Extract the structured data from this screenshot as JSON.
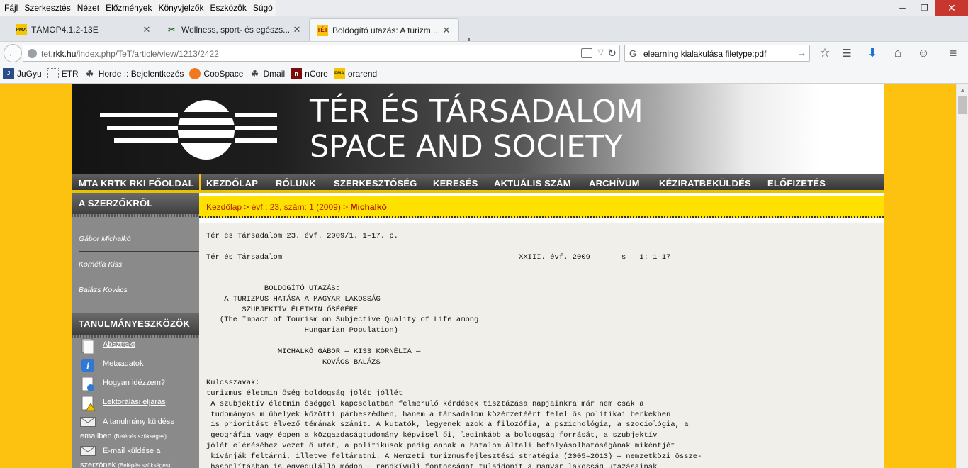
{
  "menubar": {
    "items": [
      {
        "label": "Fájl"
      },
      {
        "label": "Szerkesztés"
      },
      {
        "label": "Nézet"
      },
      {
        "label": "Előzmények"
      },
      {
        "label": "Könyvjelzők"
      },
      {
        "label": "Eszközök"
      },
      {
        "label": "Súgó"
      }
    ]
  },
  "tabs": [
    {
      "title": "TÁMOP4.1.2-13E",
      "favicon_text": "PMA",
      "active": false
    },
    {
      "title": "Wellness, sport- és egészs...",
      "favicon_text": "✂",
      "active": false
    },
    {
      "title": "Boldogító utazás: A turizm...",
      "favicon_text": "TÉT",
      "active": true
    }
  ],
  "navbar": {
    "url_prefix": "tet.",
    "url_domain": "rkk.hu",
    "url_path": "/index.php/TeT/article/view/1213/2422",
    "search_value": "elearning kialakulása filetype:pdf"
  },
  "bookmarks": [
    {
      "label": "JuGyu",
      "icon": "jugyu-icon"
    },
    {
      "label": "ETR",
      "icon": "etr-icon"
    },
    {
      "label": "Horde :: Bejelentkezés",
      "icon": "horde-icon"
    },
    {
      "label": "CooSpace",
      "icon": "coospace-icon"
    },
    {
      "label": "Dmail",
      "icon": "dmail-icon"
    },
    {
      "label": "nCore",
      "icon": "ncore-icon"
    },
    {
      "label": "orarend",
      "icon": "pma-icon"
    }
  ],
  "site": {
    "title_hu": "TÉR ÉS TÁRSADALOM",
    "title_en": "SPACE AND SOCIETY",
    "nav": [
      "MTA KRTK RKI FŐOLDAL",
      "KEZDŐLAP",
      "RÓLUNK",
      "SZERKESZTŐSÉG",
      "KERESÉS",
      "AKTUÁLIS SZÁM",
      "ARCHÍVUM",
      "KÉZIRATBEKÜLDÉS",
      "ELŐFIZETÉS"
    ],
    "sidebar": {
      "authors_heading": "A SZERZŐKRŐL",
      "authors": [
        "Gábor Michalkó",
        "Kornélia Kiss",
        "Balázs Kovács"
      ],
      "tools_heading": "TANULMÁNYESZKÖZÖK",
      "tools": [
        {
          "label": "Absztrakt",
          "icon": "document-icon"
        },
        {
          "label": "Metaadatok",
          "icon": "info-icon"
        },
        {
          "label": "Hogyan idézzem?",
          "icon": "citation-icon"
        },
        {
          "label": "Lektorálási eljárás",
          "icon": "review-icon"
        }
      ],
      "send_article_label": "A tanulmány küldése",
      "send_article_line2": "emailben",
      "send_article_note": "(Belépés szükséges)",
      "email_author_label": "E-mail küldése a",
      "email_author_line2": "szerzőnek",
      "email_author_note": "(Belépés szükséges)"
    },
    "breadcrumb": {
      "home": "Kezdőlap",
      "sep": ">",
      "issue": "évf.: 23, szám: 1 (2009)",
      "current": "Michalkó"
    },
    "article_text": "Tér és Társadalom 23. évf. 2009/1. 1–17. p.\n\nTér és Társadalom                                                     XXIII. évf. 2009       s   1: 1–17\n\n\n             BOLDOGÍTÓ UTAZÁS:\n    A TURIZMUS HATÁSA A MAGYAR LAKOSSÁG\n        SZUBJEKTÍV ÉLETMIN ŐSÉGÉRE\n   (The Impact of Tourism on Subjective Quality of Life among\n                      Hungarian Population)\n\n                MICHALKÓ GÁBOR — KISS KORNÉLIA —\n                          KOVÁCS BALÁZS\n\nKulcsszavak:\nturizmus életmin őség boldogság jólét jóllét\n A szubjektív életmin őséggel kapcsolatban felmerülő kérdések tisztázása napjainkra már nem csak a\n tudományos m űhelyek közötti párbeszédben, hanem a társadalom közérzetéért felel ős politikai berkekben\n is prioritást élvező témának számít. A kutatók, legyenek azok a filozófia, a pszichológia, a szociológia, a\n geográfia vagy éppen a közgazdaságtudomány képvisel ői, leginkább a boldogság forrását, a szubjektív\njólét eléréséhez vezet ő utat, a politikusok pedig annak a hatalom általi befolyásolhatóságának mikéntjét\n kívánják feltárni, illetve feltáratni. A Nemzeti turizmusfejlesztési stratégia (2005–2013) — nemzetközi össze-\n hasonlításban is egyedülálló módon — rendkívüli fontosságot tulajdonít a magyar lakosság utazásainak\n életmin őség-növelő szerepére. Ahhoz, hogy a dokumentumban megfogalmazottak valóban a társadalom"
  }
}
